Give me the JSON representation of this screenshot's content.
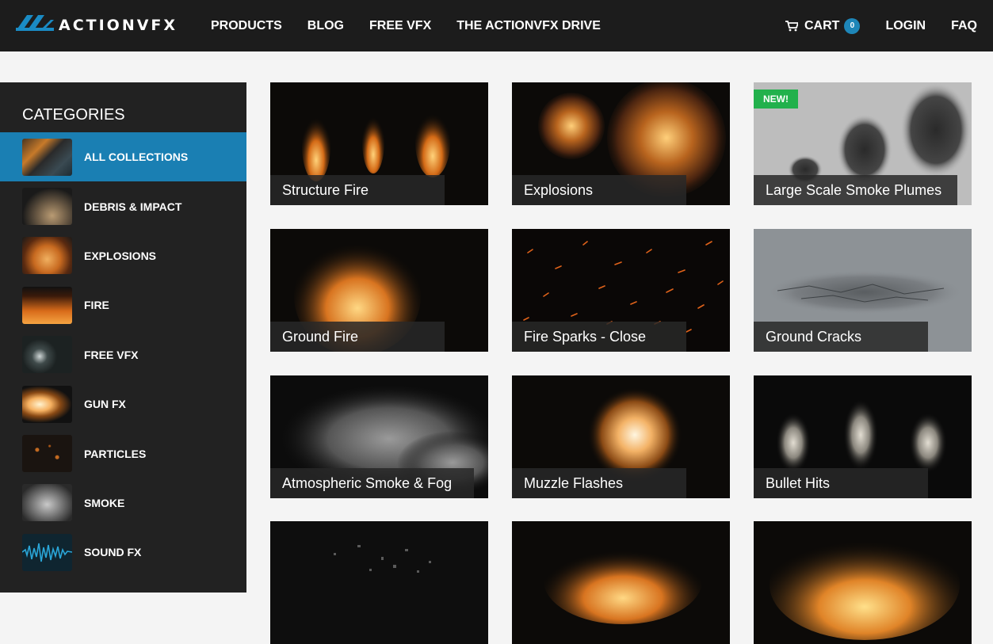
{
  "header": {
    "logo_text": "ACTIONVFX",
    "nav_left": [
      "PRODUCTS",
      "BLOG",
      "FREE VFX",
      "THE ACTIONVFX DRIVE"
    ],
    "cart_label": "CART",
    "cart_count": "0",
    "login_label": "LOGIN",
    "faq_label": "FAQ"
  },
  "sidebar": {
    "title": "CATEGORIES",
    "items": [
      {
        "label": "ALL COLLECTIONS",
        "active": true
      },
      {
        "label": "DEBRIS & IMPACT"
      },
      {
        "label": "EXPLOSIONS"
      },
      {
        "label": "FIRE"
      },
      {
        "label": "FREE VFX"
      },
      {
        "label": "GUN FX"
      },
      {
        "label": "PARTICLES"
      },
      {
        "label": "SMOKE"
      },
      {
        "label": "SOUND FX"
      }
    ]
  },
  "collections": [
    {
      "title": "Structure Fire"
    },
    {
      "title": "Explosions"
    },
    {
      "title": "Large Scale Smoke Plumes",
      "badge": "NEW!"
    },
    {
      "title": "Ground Fire"
    },
    {
      "title": "Fire Sparks - Close"
    },
    {
      "title": "Ground Cracks"
    },
    {
      "title": "Atmospheric Smoke & Fog"
    },
    {
      "title": "Muzzle Flashes"
    },
    {
      "title": "Bullet Hits"
    }
  ],
  "colors": {
    "header_bg": "#1c1c1c",
    "sidebar_bg": "#222222",
    "active_blue": "#1a7fb3",
    "new_badge": "#22b14c"
  }
}
